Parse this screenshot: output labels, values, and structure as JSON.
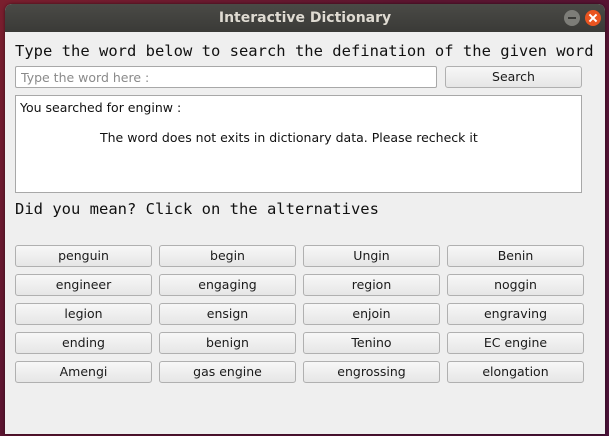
{
  "window": {
    "title": "Interactive Dictionary"
  },
  "instruction": "Type the word below to search the defination of the given word",
  "search": {
    "placeholder": "Type the word here :",
    "value": "",
    "button_label": "Search"
  },
  "result": {
    "searched_line": "You searched for enginw :",
    "message": "The word does not exits in dictionary data. Please recheck it"
  },
  "did_you_mean": "Did you mean? Click on the alternatives",
  "alternatives": [
    "penguin",
    "begin",
    "Ungin",
    "Benin",
    "engineer",
    "engaging",
    "region",
    "noggin",
    "legion",
    "ensign",
    "enjoin",
    "engraving",
    "ending",
    "benign",
    "Tenino",
    "EC engine",
    "Amengi",
    "gas engine",
    "engrossing",
    "elongation"
  ],
  "colors": {
    "close_button": "#e95420",
    "titlebar": "#3d3d3a",
    "window_bg": "#efefef"
  }
}
